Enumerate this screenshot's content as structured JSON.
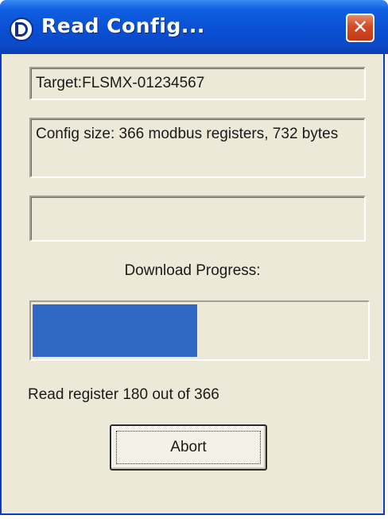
{
  "window": {
    "title": "Read Config...",
    "close_glyph": "✕",
    "app_icon": "D-logo-icon"
  },
  "fields": {
    "target": "Target:FLSMX-01234567",
    "config_size": "Config size: 366 modbus registers, 732 bytes",
    "status": ""
  },
  "progress": {
    "label": "Download Progress:",
    "value": 180,
    "max": 366,
    "fill_color": "#2f68c5"
  },
  "status_line": "Read register 180 out of 366",
  "buttons": {
    "abort_label": "Abort"
  },
  "colors": {
    "titlebar": "#0a4fd4",
    "dialog_background": "#ece9d8",
    "close_button": "#d24a25"
  }
}
